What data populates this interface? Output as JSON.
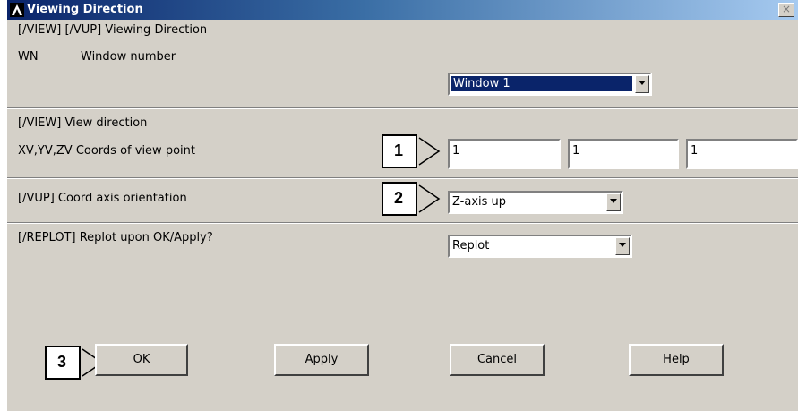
{
  "window": {
    "title": "Viewing Direction",
    "close_glyph": "×"
  },
  "form": {
    "header": "[/VIEW] [/VUP] Viewing Direction",
    "wn_code": "WN",
    "wn_label": "Window number",
    "wn_value": "Window 1",
    "view_section": "[/VIEW]  View direction",
    "coords_label": "XV,YV,ZV  Coords of view point",
    "coords": [
      "1",
      "1",
      "1"
    ],
    "vup_label": "[/VUP]  Coord axis orientation",
    "vup_value": "Z-axis up",
    "replot_label": "[/REPLOT] Replot upon OK/Apply?",
    "replot_value": "Replot"
  },
  "buttons": {
    "ok": "OK",
    "apply": "Apply",
    "cancel": "Cancel",
    "help": "Help"
  },
  "callouts": [
    "1",
    "2",
    "3"
  ],
  "colors": {
    "title_bar_start": "#0a246a",
    "title_bar_end": "#a6caf0",
    "dialog_bg": "#d4d0c8",
    "selection": "#0a246a"
  }
}
